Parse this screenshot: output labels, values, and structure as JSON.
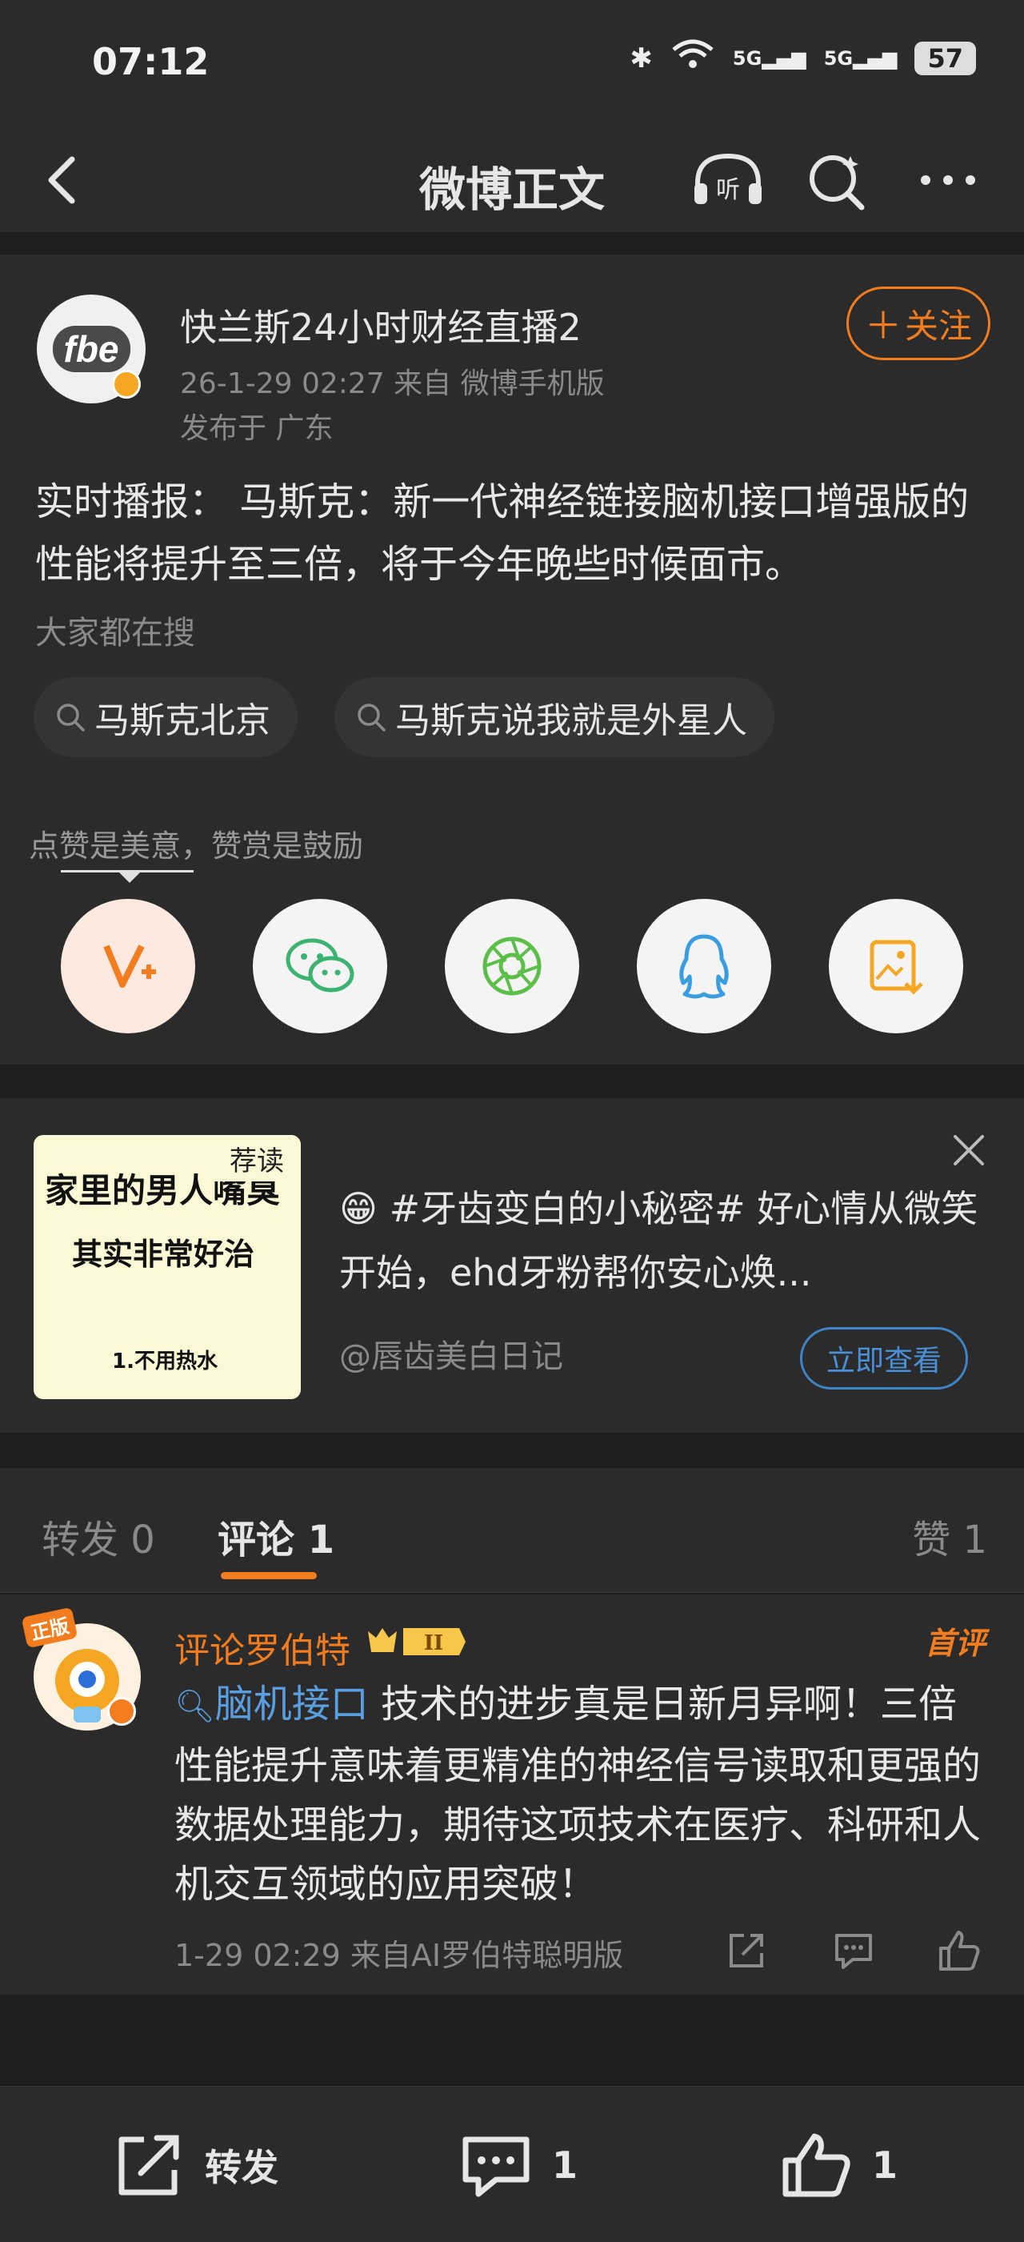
{
  "status_bar": {
    "time": "07:12",
    "signal1": "5G",
    "signal2": "5G",
    "battery": "57"
  },
  "nav": {
    "title": "微博正文"
  },
  "post": {
    "avatar_text": "fbe",
    "username": "快兰斯24小时财经直播2",
    "time_source": "26-1-29 02:27  来自 微博手机版",
    "location": "发布于 广东",
    "follow_label": "关注",
    "content": "实时播报： 马斯克：新一代神经链接脑机接口增强版的性能将提升至三倍，将于今年晚些时候面市。",
    "search_heading": "大家都在搜",
    "search_chips": [
      "马斯克北京",
      "马斯克说我就是外星人"
    ],
    "like_hint": "点赞是美意，赞赏是鼓励"
  },
  "ad": {
    "image_tag": "荐读",
    "image_line1": "家里的男人嘴臭",
    "image_line2": "其实非常好治",
    "image_line3": "1.不用热水",
    "text": "😁 #牙齿变白的小秘密# 好心情从微笑开始，ehd牙粉帮你安心焕...",
    "source": "@唇齿美白日记",
    "button": "立即查看"
  },
  "tabs": {
    "repost": "转发 0",
    "comment": "评论 1",
    "like": "赞 1"
  },
  "comment": {
    "badge": "正版",
    "name": "评论罗伯特",
    "level": "II",
    "top_label": "首评",
    "link_text": "脑机接口",
    "text": " 技术的进步真是日新月异啊！三倍性能提升意味着更精准的神经信号读取和更强的数据处理能力，期待这项技术在医疗、科研和人机交互领域的应用突破！",
    "meta": "1-29 02:29  来自AI罗伯特聪明版"
  },
  "bottom_bar": {
    "repost": "转发",
    "comment_count": "1",
    "like_count": "1"
  },
  "colors": {
    "accent": "#f27c1e",
    "link": "#5b9ee0",
    "background": "#2b2b2b"
  }
}
